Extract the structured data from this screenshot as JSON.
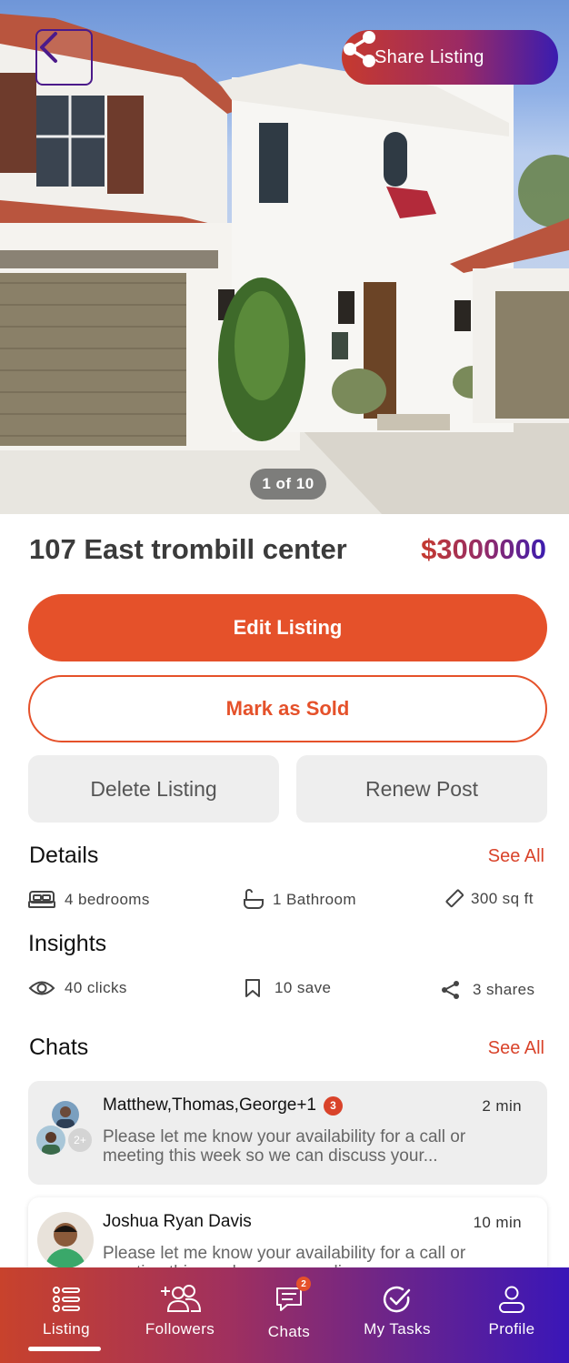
{
  "hero": {
    "share_label": "Share Listing",
    "counter": "1 of 10"
  },
  "listing": {
    "title": "107 East trombill center",
    "price": "$3000000"
  },
  "actions": {
    "edit": "Edit Listing",
    "sold": "Mark as Sold",
    "delete": "Delete Listing",
    "renew": "Renew Post"
  },
  "details": {
    "title": "Details",
    "see_all": "See All",
    "bedrooms": "4 bedrooms",
    "bathroom": "1 Bathroom",
    "area": "300 sq ft"
  },
  "insights": {
    "title": "Insights",
    "clicks": "40 clicks",
    "saves": "10 save",
    "shares": "3 shares"
  },
  "chats": {
    "title": "Chats",
    "see_all": "See All",
    "items": [
      {
        "name": "Matthew,Thomas,George+1",
        "badge": "3",
        "avatar_extra": "2+",
        "time": "2 min",
        "message": "Please let me know your availability for a call or meeting this week so we can discuss your..."
      },
      {
        "name": "Joshua Ryan Davis",
        "time": "10 min",
        "message": "Please let me know your availability for a call or meeting this week so we can discuss your..."
      }
    ]
  },
  "nav": {
    "items": [
      {
        "label": "Listing",
        "icon": "list-icon"
      },
      {
        "label": "Followers",
        "icon": "followers-icon"
      },
      {
        "label": "Chats",
        "icon": "chat-icon",
        "badge": "2"
      },
      {
        "label": "My Tasks",
        "icon": "check-circle-icon"
      },
      {
        "label": "Profile",
        "icon": "user-icon"
      }
    ]
  },
  "colors": {
    "accent": "#e5512a",
    "gradient_start": "#c63a2e",
    "gradient_end": "#3a1cb0"
  }
}
